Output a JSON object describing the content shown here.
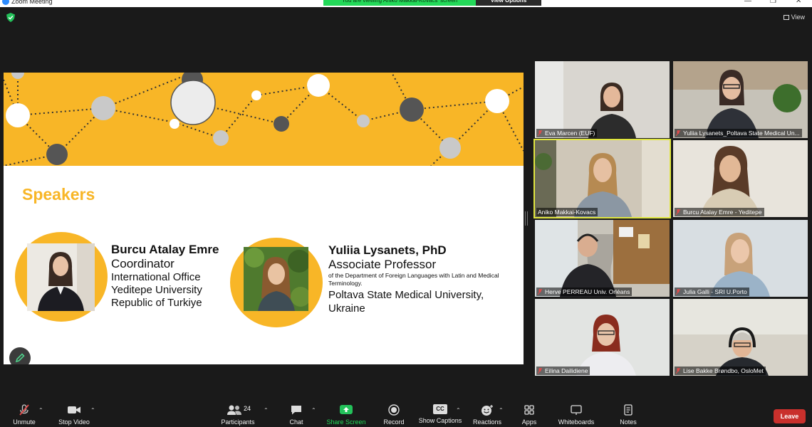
{
  "window": {
    "title": "Zoom Meeting",
    "share_banner": "You are viewing Aniko Makkai-Kovacs' screen",
    "view_options": "View Options",
    "view_label": "View"
  },
  "slide": {
    "heading": "Speakers",
    "speaker1": {
      "name": "Burcu Atalay Emre",
      "role": "Coordinator",
      "lines": [
        "International Office",
        "Yeditepe University",
        "Republic of Turkiye"
      ]
    },
    "speaker2": {
      "name": "Yuliia Lysanets, PhD",
      "role": "Associate Professor",
      "dept": "of the Department of Foreign Languages with Latin and Medical Terminology.",
      "lines": [
        "Poltava State Medical University,",
        "Ukraine"
      ]
    },
    "colors": {
      "accent": "#f8b627"
    }
  },
  "participants": [
    {
      "name": "Eva Marcen (EUF)"
    },
    {
      "name": "Yuliia Lysanets_Poltava State Medical Un..."
    },
    {
      "name": "Aniko Makkai-Kovacs"
    },
    {
      "name": "Burcu Atalay Emre - Yeditepe"
    },
    {
      "name": "Herve PERREAU Univ. Orléans"
    },
    {
      "name": "Julia Galli - SRI U.Porto"
    },
    {
      "name": "Eilina Dailidiene"
    },
    {
      "name": "Lise Bakke Brøndbo, OsloMet"
    }
  ],
  "toolbar": {
    "unmute": "Unmute",
    "stop_video": "Stop Video",
    "participants": "Participants",
    "participants_count": "24",
    "chat": "Chat",
    "share_screen": "Share Screen",
    "record": "Record",
    "show_captions": "Show Captions",
    "cc": "CC",
    "reactions": "Reactions",
    "apps": "Apps",
    "whiteboards": "Whiteboards",
    "notes": "Notes",
    "leave": "Leave"
  }
}
